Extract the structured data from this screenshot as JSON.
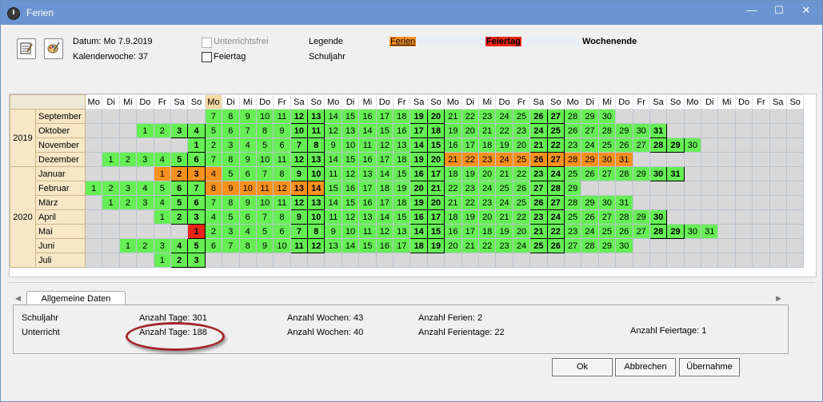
{
  "window": {
    "title": "Ferien",
    "minimize": "—",
    "maximize": "☐",
    "close": "✕"
  },
  "info": {
    "date_label": "Datum: Mo 7.9.2019",
    "week_label": "Kalenderwoche: 37",
    "checkbox_unterrichtsfrei": "Unterrichtsfrei",
    "checkbox_feiertag": "Feiertag",
    "legende_label": "Legende",
    "schuljahr_label": "Schuljahr",
    "legend_ferien": "Ferien",
    "legend_feiertag": "Feiertag",
    "legend_wochenende": "Wochenende"
  },
  "colors": {
    "ferien": "#f7911e",
    "feiertag": "#e82616",
    "schultag": "#66ee55",
    "empty": "#d8d8d8",
    "month_header": "#f8e7c7",
    "title_bar": "#6b95d0"
  },
  "calendar": {
    "weekday_headers": [
      "Mo",
      "Di",
      "Mi",
      "Do",
      "Fr",
      "Sa",
      "So",
      "Mo",
      "Di",
      "Mi",
      "Do",
      "Fr",
      "Sa",
      "So",
      "Mo",
      "Di",
      "Mi",
      "Do",
      "Fr",
      "Sa",
      "So",
      "Mo",
      "Di",
      "Mi",
      "Do",
      "Fr",
      "Sa",
      "So",
      "Mo",
      "Di",
      "Mi",
      "Do",
      "Fr",
      "Sa",
      "So",
      "Mo",
      "Di",
      "Mi",
      "Do",
      "Fr",
      "Sa",
      "So"
    ],
    "years": [
      {
        "label": "2019",
        "rows": 4
      },
      {
        "label": "2020",
        "rows": 7
      }
    ],
    "months": [
      {
        "name": "September",
        "offset": 7,
        "days": 24,
        "first_day": 7,
        "ferien": [],
        "feiertag": []
      },
      {
        "name": "Oktober",
        "offset": 3,
        "days": 31,
        "first_day": 1,
        "ferien": [],
        "feiertag": []
      },
      {
        "name": "November",
        "offset": 6,
        "days": 30,
        "first_day": 1,
        "ferien": [],
        "feiertag": []
      },
      {
        "name": "Dezember",
        "offset": 1,
        "days": 31,
        "first_day": 1,
        "ferien": [
          21,
          22,
          23,
          24,
          25,
          26,
          27,
          28,
          29,
          30,
          31
        ],
        "feiertag": []
      },
      {
        "name": "Januar",
        "offset": 4,
        "days": 31,
        "first_day": 1,
        "ferien": [
          1,
          2,
          3,
          4
        ],
        "feiertag": []
      },
      {
        "name": "Februar",
        "offset": 0,
        "days": 29,
        "first_day": 1,
        "ferien": [
          8,
          9,
          10,
          11,
          12,
          13,
          14
        ],
        "feiertag": []
      },
      {
        "name": "März",
        "offset": 1,
        "days": 31,
        "first_day": 1,
        "ferien": [],
        "feiertag": []
      },
      {
        "name": "April",
        "offset": 4,
        "days": 30,
        "first_day": 1,
        "ferien": [],
        "feiertag": []
      },
      {
        "name": "Mai",
        "offset": 6,
        "days": 31,
        "first_day": 1,
        "ferien": [],
        "feiertag": [
          1
        ]
      },
      {
        "name": "Juni",
        "offset": 2,
        "days": 30,
        "first_day": 1,
        "ferien": [],
        "feiertag": []
      },
      {
        "name": "Juli",
        "offset": 4,
        "days": 3,
        "first_day": 1,
        "ferien": [],
        "feiertag": []
      }
    ]
  },
  "tabs": {
    "general": "Allgemeine Daten",
    "scroll_left": "◀",
    "scroll_right": "▶"
  },
  "stats": {
    "schuljahr": "Schuljahr",
    "unterricht": "Unterricht",
    "anzahl_tage_schuljahr": "Anzahl Tage: 301",
    "anzahl_tage_unterricht": "Anzahl Tage: 188",
    "anzahl_wochen_schuljahr": "Anzahl Wochen: 43",
    "anzahl_wochen_unterricht": "Anzahl Wochen: 40",
    "anzahl_ferien": "Anzahl Ferien: 2",
    "anzahl_ferientage": "Anzahl Ferientage: 22",
    "anzahl_feiertage": "Anzahl Feiertage: 1"
  },
  "buttons": {
    "ok": "Ok",
    "abbrechen": "Abbrechen",
    "uebernahme": "Übernahme"
  }
}
